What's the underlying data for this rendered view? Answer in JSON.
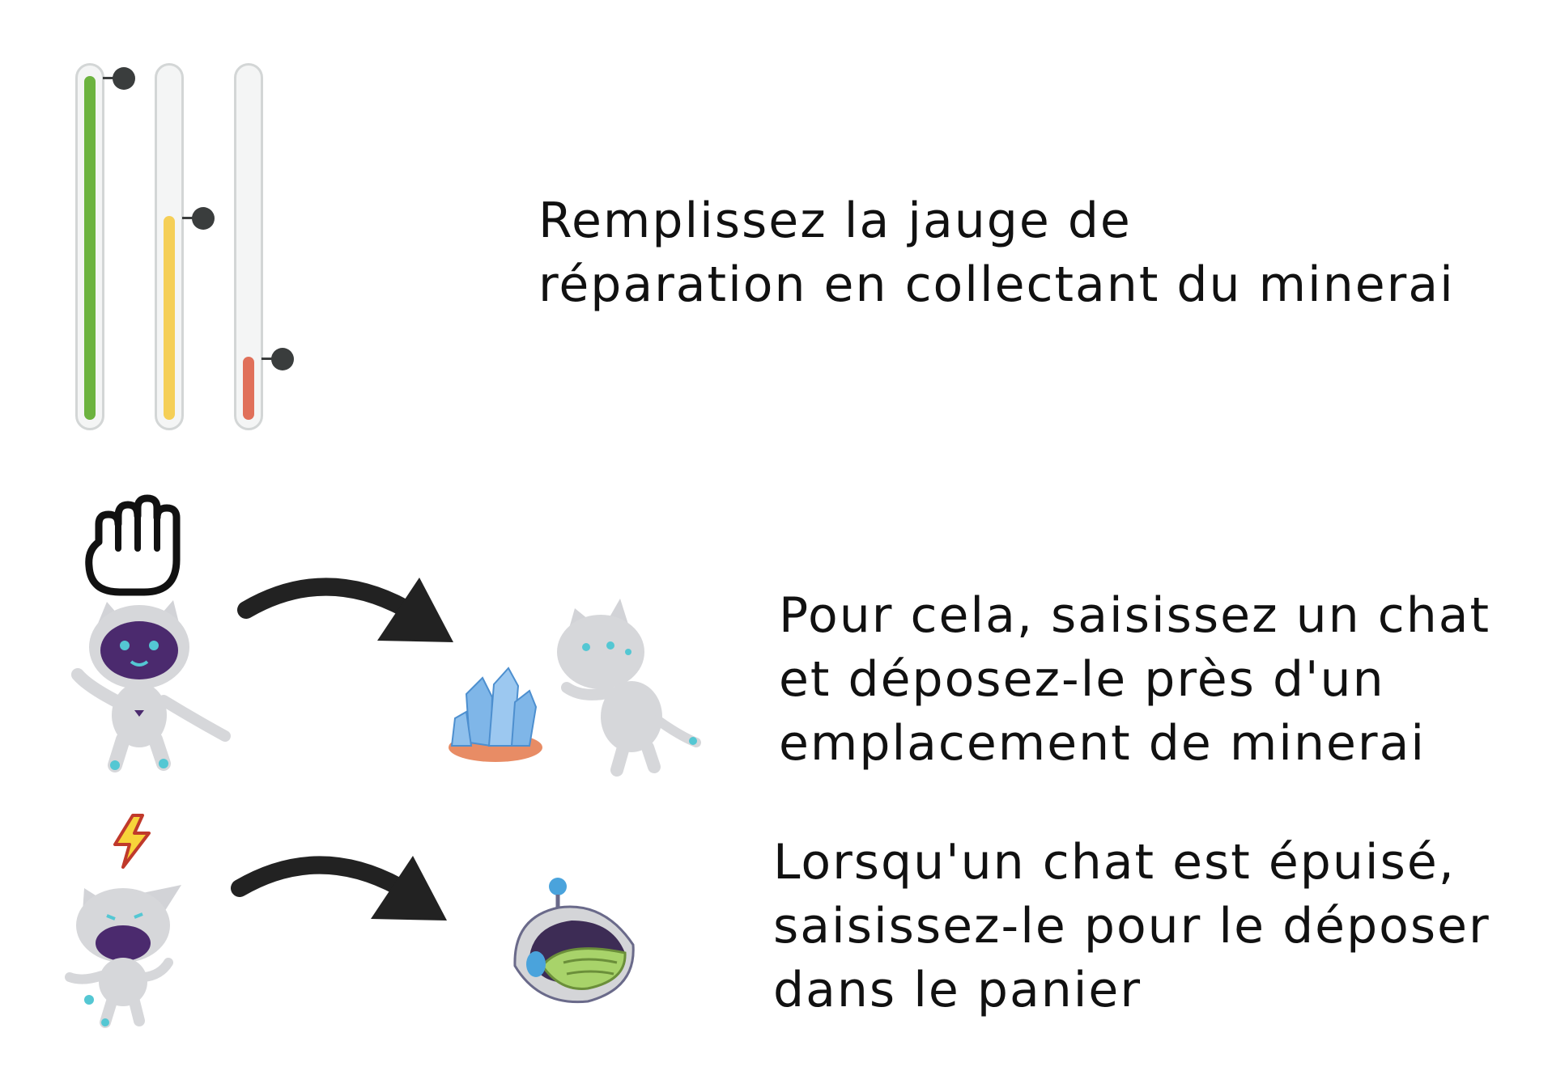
{
  "gauges": [
    {
      "name": "green",
      "fill_level": 0.98,
      "color": "#6cb33f"
    },
    {
      "name": "yellow",
      "fill_level": 0.58,
      "color": "#f5cf57"
    },
    {
      "name": "red",
      "fill_level": 0.18,
      "color": "#e0705a"
    }
  ],
  "instructions": {
    "step1": {
      "lines": [
        "Remplissez la jauge de",
        "réparation en collectant du minerai"
      ]
    },
    "step2": {
      "lines": [
        "Pour cela, saisissez un chat",
        "et déposez-le près d'un",
        "emplacement de minerai"
      ]
    },
    "step3": {
      "lines": [
        "Lorsqu'un chat est épuisé,",
        "saisissez-le pour le déposer",
        "dans le panier"
      ]
    }
  },
  "icons": {
    "grab": "hand-grab-icon",
    "arrow": "curved-arrow-icon",
    "energy": "lightning-bolt-icon",
    "cat": "cat-robot-icon",
    "ore": "crystal-ore-icon",
    "basket": "cat-basket-icon"
  },
  "colors": {
    "text": "#111111",
    "cat_body": "#d6d7da",
    "cat_face": "#4b2a6e",
    "cat_eyes": "#54c7d3",
    "crystal": "#7fb6e8",
    "ore_base": "#e4784a",
    "basket_cushion": "#a8d36a",
    "lightning": "#f7d33a"
  }
}
